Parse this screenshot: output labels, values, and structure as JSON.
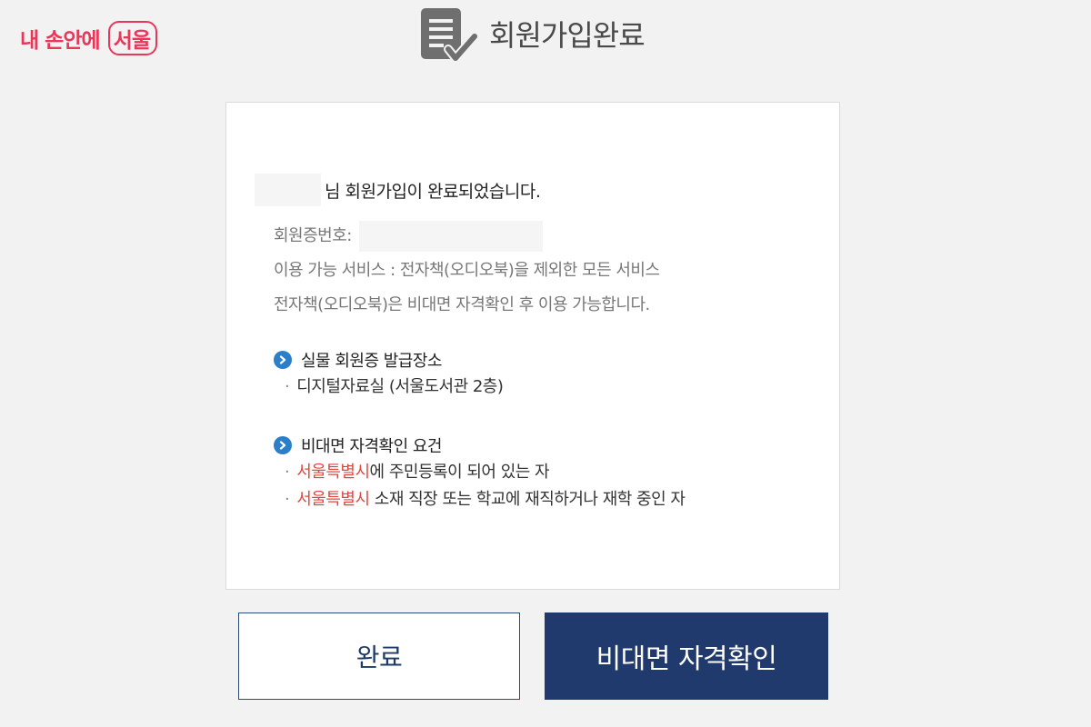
{
  "logo": {
    "part1": "내 손안에 ",
    "part2": "서울"
  },
  "header": {
    "title": "회원가입완료",
    "icon": "document-check-icon"
  },
  "card": {
    "greeting_suffix": "님 회원가입이 완료되었습니다.",
    "member_number_label": "회원증번호:",
    "service_line": "이용 가능 서비스 : 전자책(오디오북)을 제외한 모든 서비스",
    "ebook_line": "전자책(오디오북)은 비대면 자격확인 후 이용 가능합니다.",
    "issue_section": {
      "title": "실물 회원증 발급장소",
      "items": [
        "디지털자료실 (서울도서관 2층)"
      ]
    },
    "remote_section": {
      "title": "비대면 자격확인 요건",
      "items": [
        {
          "highlight": "서울특별시",
          "rest": "에 주민등록이 되어 있는 자"
        },
        {
          "highlight": "서울특별시",
          "rest": " 소재 직장 또는 학교에 재직하거나 재학 중인 자"
        }
      ]
    },
    "bullet_dot": "·"
  },
  "buttons": {
    "done": "완료",
    "verify": "비대면 자격확인"
  },
  "colors": {
    "accent_navy": "#213a6e",
    "highlight_red": "#e0473f",
    "logo_pink": "#e8385a",
    "bullet_blue": "#2a7fc8"
  }
}
